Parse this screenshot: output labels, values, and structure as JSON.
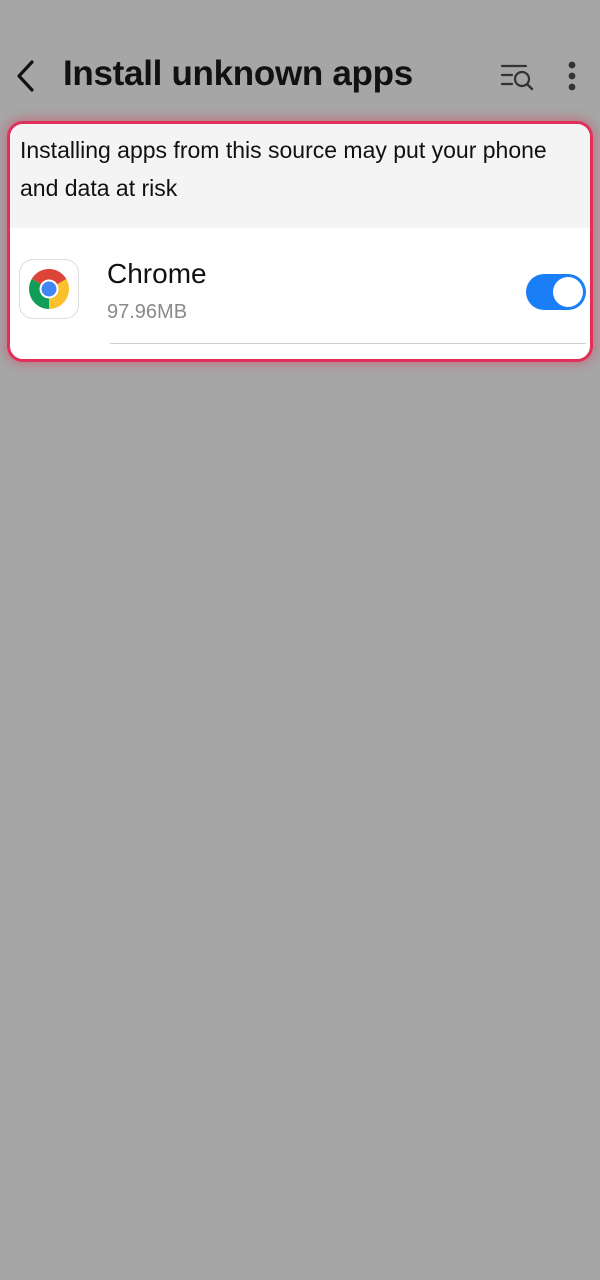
{
  "header": {
    "title": "Install unknown apps",
    "back_icon": "back-arrow-icon",
    "filter_icon": "filter-search-icon",
    "more_icon": "more-vertical-icon"
  },
  "warning": {
    "text": "Installing apps from this source may put your phone and data at risk"
  },
  "app": {
    "name": "Chrome",
    "size": "97.96MB",
    "icon": "chrome-icon",
    "toggle_on": true
  },
  "colors": {
    "highlight_border": "#e0305a",
    "toggle_on": "#1a7ef7",
    "background_dim": "#a6a6a6"
  }
}
